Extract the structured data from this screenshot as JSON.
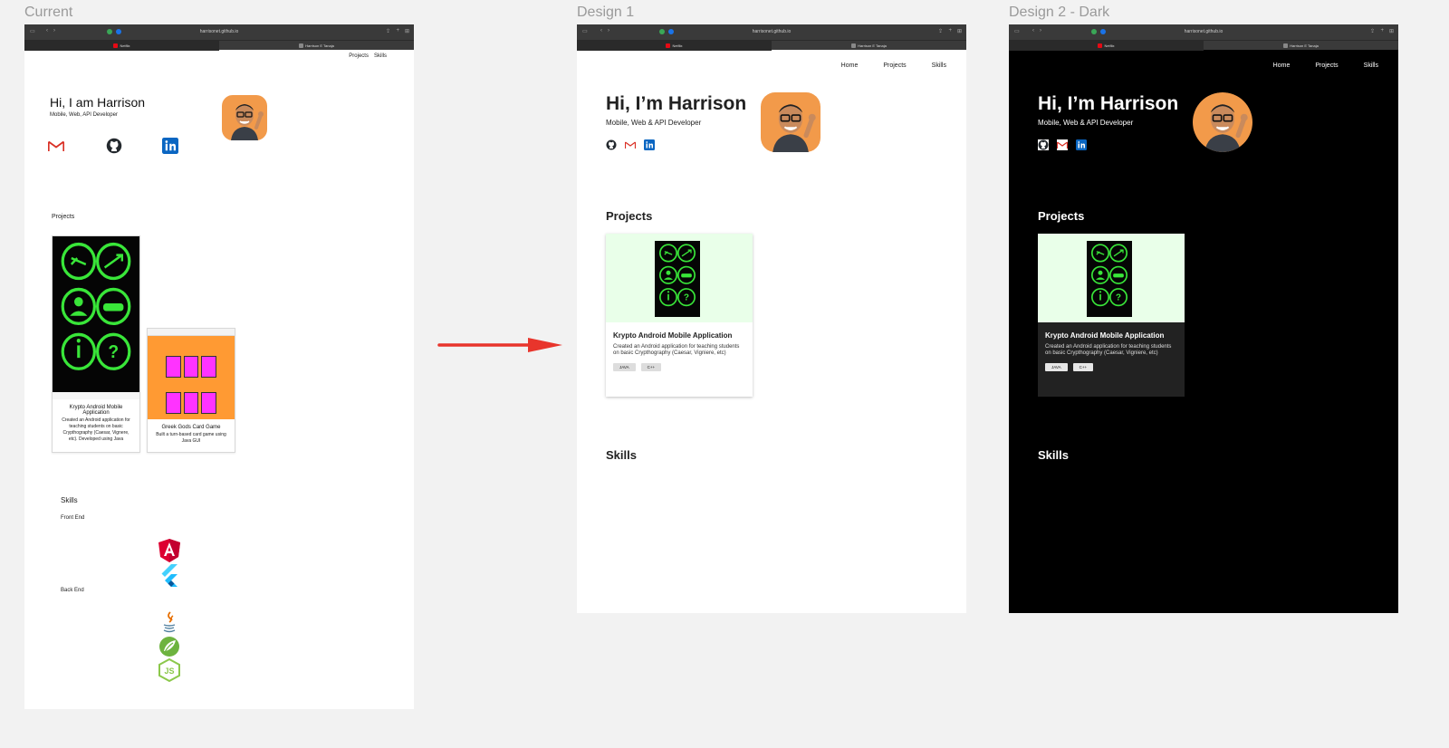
{
  "frames": {
    "current_label": "Current",
    "design1_label": "Design 1",
    "design2_label": "Design 2 - Dark"
  },
  "browser": {
    "url": "harrisonet.github.io",
    "tab1": "Netflix",
    "tab2": "Harrison E Tanaja"
  },
  "current": {
    "nav": [
      "Projects",
      "Skills"
    ],
    "title": "Hi, I am Harrison",
    "subtitle": "Mobile, Web, API Developer",
    "projects_label": "Projects",
    "cards": [
      {
        "title": "Krypto Android Mobile Application",
        "desc": "Created an Android application for teaching students on basic Crypthography (Caesar, Vignere, etc). Developed using Java"
      },
      {
        "title": "Greek Gods Card Game",
        "desc": "Built a turn-based card game using Java GUI"
      }
    ],
    "skills_label": "Skills",
    "front_end": "Front End",
    "back_end": "Back End"
  },
  "design": {
    "nav": [
      "Home",
      "Projects",
      "Skills"
    ],
    "title": "Hi, I’m Harrison",
    "subtitle": "Mobile, Web & API Developer",
    "projects_label": "Projects",
    "skills_label": "Skills",
    "card": {
      "title": "Krypto Android Mobile Application",
      "desc": "Created an Android application for teaching students on basic Crypthography (Caesar, Vigniere, etc)",
      "tags": [
        "JAVA",
        "C++"
      ]
    }
  },
  "colors": {
    "arrow": "#e8352c",
    "card_bg": "#e9ffe9",
    "neon_green": "#39e639",
    "orange": "#ff9a33",
    "magenta": "#ff33ff",
    "gmail_red": "#d93025",
    "linkedin_blue": "#0a66c2"
  },
  "icons": [
    "gmail-icon",
    "github-icon",
    "linkedin-icon",
    "angular-icon",
    "flutter-icon",
    "java-icon",
    "spring-icon",
    "nodejs-icon"
  ]
}
